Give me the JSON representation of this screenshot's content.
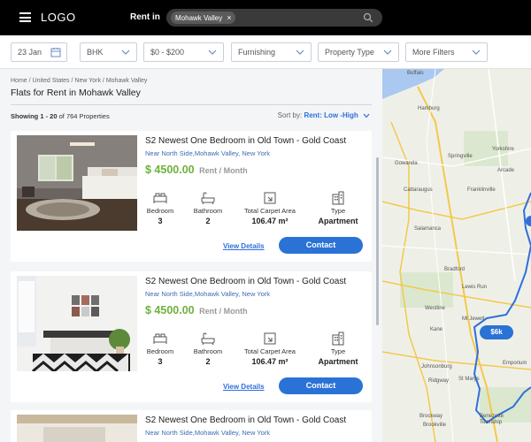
{
  "header": {
    "logo": "LOGO",
    "rent_in_label": "Rent in",
    "search_chip": "Mohawk Valley",
    "chip_remove": "×"
  },
  "filters": {
    "date": "23 Jan",
    "bhk": "BHK",
    "price": "$0 - $200",
    "furnishing": "Furnishing",
    "property_type": "Property Type",
    "more": "More Filters"
  },
  "breadcrumb": [
    "Home",
    "United States",
    "New York",
    "Mohawk Valley"
  ],
  "page_title": "Flats for Rent in Mohawk Valley",
  "results": {
    "showing_bold": "Showing 1 - 20",
    "showing_rest": " of 764 Properties",
    "sort_label": "Sort by:",
    "sort_value": "Rent: Low -High"
  },
  "listings": [
    {
      "title": "S2 Newest One Bedroom in Old Town - Gold Coast",
      "address": "Near North Side,Mohawk Valley, New York",
      "price": "$ 4500.00",
      "per": "Rent / Month",
      "bedroom_label": "Bedroom",
      "bedroom": "3",
      "bathroom_label": "Bathroom",
      "bathroom": "2",
      "area_label": "Total Carpet Area",
      "area": "106.47 m²",
      "type_label": "Type",
      "type": "Apartment",
      "view_details": "View Details",
      "contact": "Contact"
    },
    {
      "title": "S2 Newest One Bedroom in Old Town - Gold Coast",
      "address": "Near North Side,Mohawk Valley, New York",
      "price": "$ 4500.00",
      "per": "Rent / Month",
      "bedroom_label": "Bedroom",
      "bedroom": "3",
      "bathroom_label": "Bathroom",
      "bathroom": "2",
      "area_label": "Total Carpet Area",
      "area": "106.47 m²",
      "type_label": "Type",
      "type": "Apartment",
      "view_details": "View Details",
      "contact": "Contact"
    },
    {
      "title": "S2 Newest One Bedroom in Old Town - Gold Coast",
      "address": "Near North Side,Mohawk Valley, New York"
    }
  ],
  "map": {
    "price_badge": "$6k",
    "places": [
      "Buffalo",
      "Hamburg",
      "Springville",
      "Yorkshire",
      "Gowanda",
      "Arcade",
      "Cattaraugus",
      "Franklinville",
      "Salamanca",
      "Bradford",
      "Lewis Run",
      "Westline",
      "Mt Jewett",
      "Kane",
      "Emporium",
      "Johnsonburg",
      "Ridgway",
      "St Marys",
      "Brockway",
      "Brookville",
      "Benezette Township"
    ]
  },
  "colors": {
    "accent": "#2a72d6",
    "price": "#6cb23c",
    "topbar": "#000000"
  }
}
